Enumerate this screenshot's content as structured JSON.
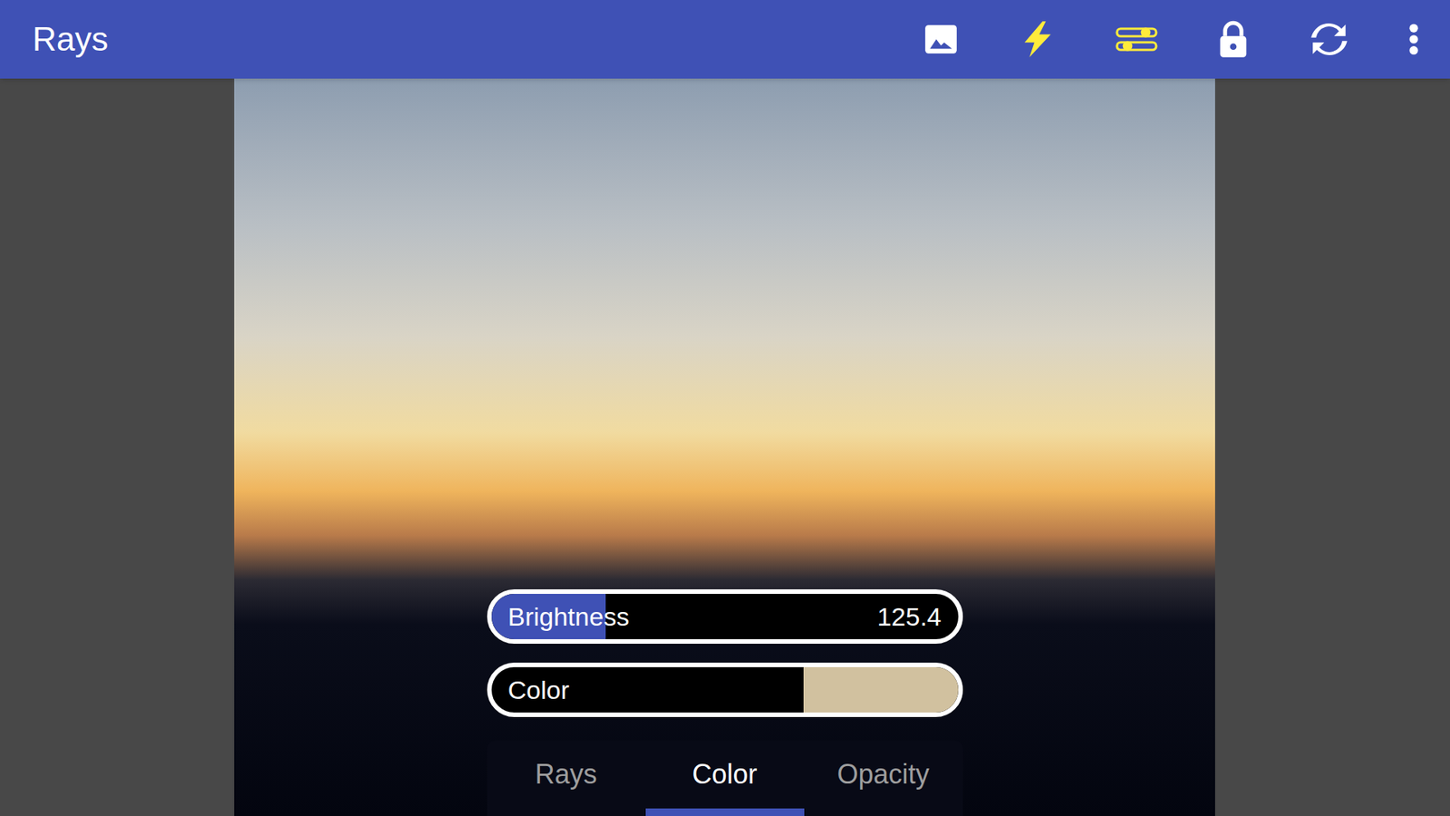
{
  "app_bar": {
    "title": "Rays"
  },
  "brightness": {
    "label": "Brightness",
    "value": "125.4",
    "level": 0.245
  },
  "color_row": {
    "label": "Color",
    "color": "#d1c19f"
  },
  "tabs": [
    {
      "label": "Rays",
      "selected": false
    },
    {
      "label": "Color",
      "selected": true
    },
    {
      "label": "Opacity",
      "selected": false
    }
  ]
}
